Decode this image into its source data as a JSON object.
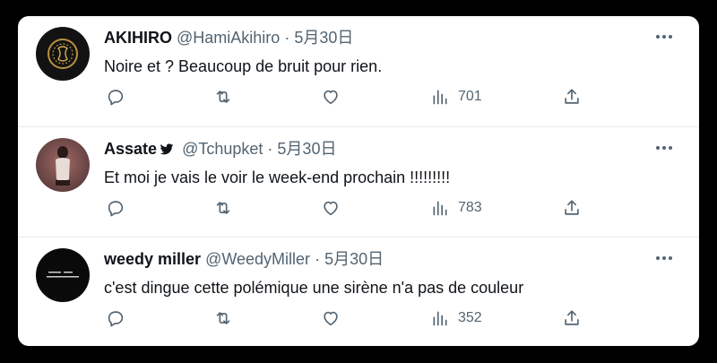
{
  "tweets": [
    {
      "name": "AKIHIRO",
      "handle": "@HamiAkihiro",
      "separator": "·",
      "date": "5月30日",
      "text": "Noire et ? Beaucoup de bruit pour rien.",
      "views": "701",
      "verified_icon": false
    },
    {
      "name": "Assate",
      "handle": "@Tchupket",
      "separator": "·",
      "date": "5月30日",
      "text": "Et moi je vais le voir le week-end prochain !!!!!!!!!",
      "views": "783",
      "verified_icon": true
    },
    {
      "name": "weedy miller",
      "handle": "@WeedyMiller",
      "separator": "·",
      "date": "5月30日",
      "text": "c'est dingue cette polémique une  sirène n'a pas de couleur",
      "views": "352",
      "verified_icon": false
    }
  ],
  "icons": {
    "reply": "reply-icon",
    "retweet": "retweet-icon",
    "like": "heart-icon",
    "views": "analytics-icon",
    "share": "share-icon",
    "more": "more-icon",
    "bird": "bird-icon"
  },
  "colors": {
    "page_background": "#000000",
    "card_background": "#ffffff",
    "text_primary": "#0f1419",
    "text_secondary": "#536471",
    "divider": "#e6ecf0"
  }
}
